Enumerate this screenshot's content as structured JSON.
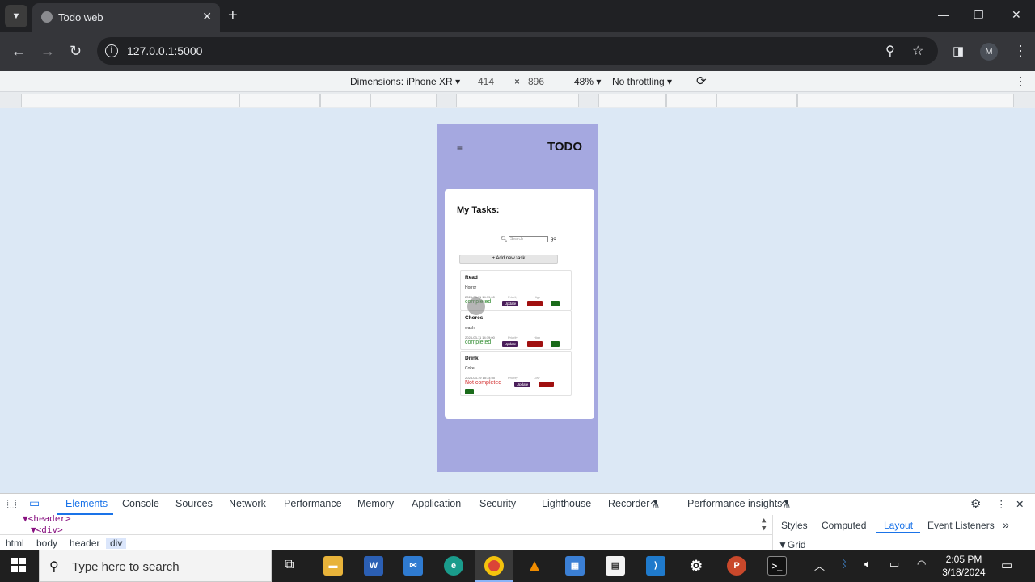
{
  "browser": {
    "tab_title": "Todo web",
    "url": "127.0.0.1:5000",
    "profile_initial": "M"
  },
  "device_toolbar": {
    "dimensions_label": "Dimensions: iPhone XR",
    "width": "414",
    "times": "×",
    "height": "896",
    "zoom": "48%",
    "throttling": "No throttling"
  },
  "app": {
    "menu_icon": "≡",
    "title": "TODO",
    "heading": "My Tasks:",
    "search_placeholder": "Search",
    "search_go": "go",
    "add_task": "+ Add new task",
    "update_label": "Update",
    "tasks": [
      {
        "title": "Read",
        "description": "Horror",
        "date": "2024-03-11 14:19:00",
        "priority": "Priority",
        "level": "High",
        "status": "completed",
        "completed": true
      },
      {
        "title": "Chores",
        "description": "wash",
        "date": "2024-03-11 14:19:00",
        "priority": "Priority",
        "level": "High",
        "status": "completed",
        "completed": true
      },
      {
        "title": "Drink",
        "description": "Coke",
        "date": "2024-03-19 15:34:00",
        "priority": "Priority",
        "level": "Low",
        "status": "Not completed",
        "completed": false
      }
    ]
  },
  "devtools": {
    "tabs": [
      "Elements",
      "Console",
      "Sources",
      "Network",
      "Performance",
      "Memory",
      "Application",
      "Security",
      "Lighthouse",
      "Recorder",
      "Performance insights"
    ],
    "active_tab": "Elements",
    "code_line_1": "▼<header>",
    "code_line_2": "▼<div>",
    "breadcrumbs": [
      "html",
      "body",
      "header",
      "div"
    ],
    "side_tabs": [
      "Styles",
      "Computed",
      "Layout",
      "Event Listeners"
    ],
    "side_active": "Layout",
    "grid_label": "▼Grid"
  },
  "taskbar": {
    "search_placeholder": "Type here to search",
    "time": "2:05 PM",
    "date": "3/18/2024"
  },
  "colors": {
    "phone_bg": "#a5a8e0",
    "viewport_bg": "#dce8f5",
    "status_completed": "#2e8b2e",
    "status_not_completed": "#d32f2f",
    "update_button": "#4a1e5a",
    "delete_button": "#a01010",
    "done_button": "#1a6b1a",
    "devtools_accent": "#1a73e8"
  }
}
